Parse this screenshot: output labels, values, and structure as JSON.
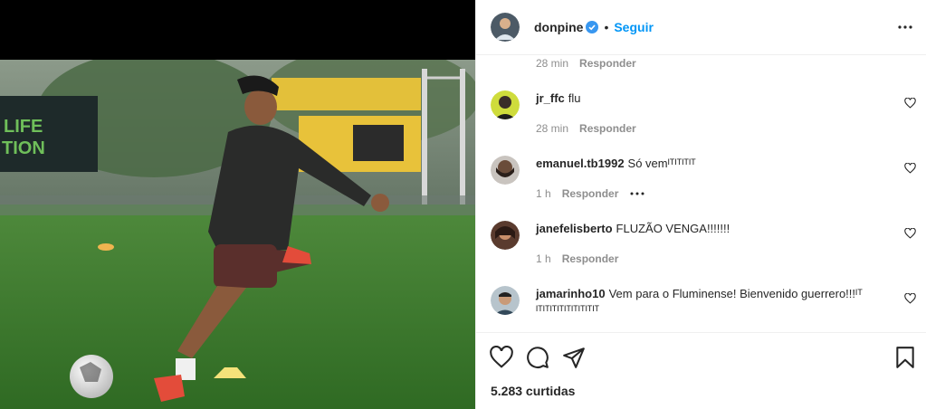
{
  "post": {
    "username": "donpine",
    "follow_label": "Seguir",
    "likes_text": "5.283 curtidas"
  },
  "first_meta": {
    "time": "28 min",
    "reply_label": "Responder"
  },
  "comments": [
    {
      "user": "jr_ffc",
      "text": "flu",
      "text2": "",
      "time": "28 min",
      "reply": "Responder",
      "has_options": false
    },
    {
      "user": "emanuel.tb1992",
      "text": "Só vemᴵᵀᴵᵀᴵᵀᴵᵀ",
      "text2": "",
      "time": "1 h",
      "reply": "Responder",
      "has_options": true
    },
    {
      "user": "janefelisberto",
      "text": "FLUZÃO VENGA!!!!!!!",
      "text2": "",
      "time": "1 h",
      "reply": "Responder",
      "has_options": false
    },
    {
      "user": "jamarinho10",
      "text": "Vem para o Fluminense! Bienvenido guerrero!!!ᴵᵀ",
      "text2": "ᴵᵀᴵᵀᴵᵀᴵᵀᴵᵀᴵᵀᴵᵀᴵᵀᴵᵀ",
      "time": "",
      "reply": "",
      "has_options": false
    }
  ],
  "icons": {
    "verified": "verified-badge-icon",
    "more": "more-options-icon",
    "like": "heart-icon",
    "comment": "comment-icon",
    "share": "paper-plane-icon",
    "save": "bookmark-icon"
  },
  "colors": {
    "accent": "#0095f6",
    "muted": "#8e8e8e",
    "text": "#262626",
    "divider": "#efefef"
  }
}
